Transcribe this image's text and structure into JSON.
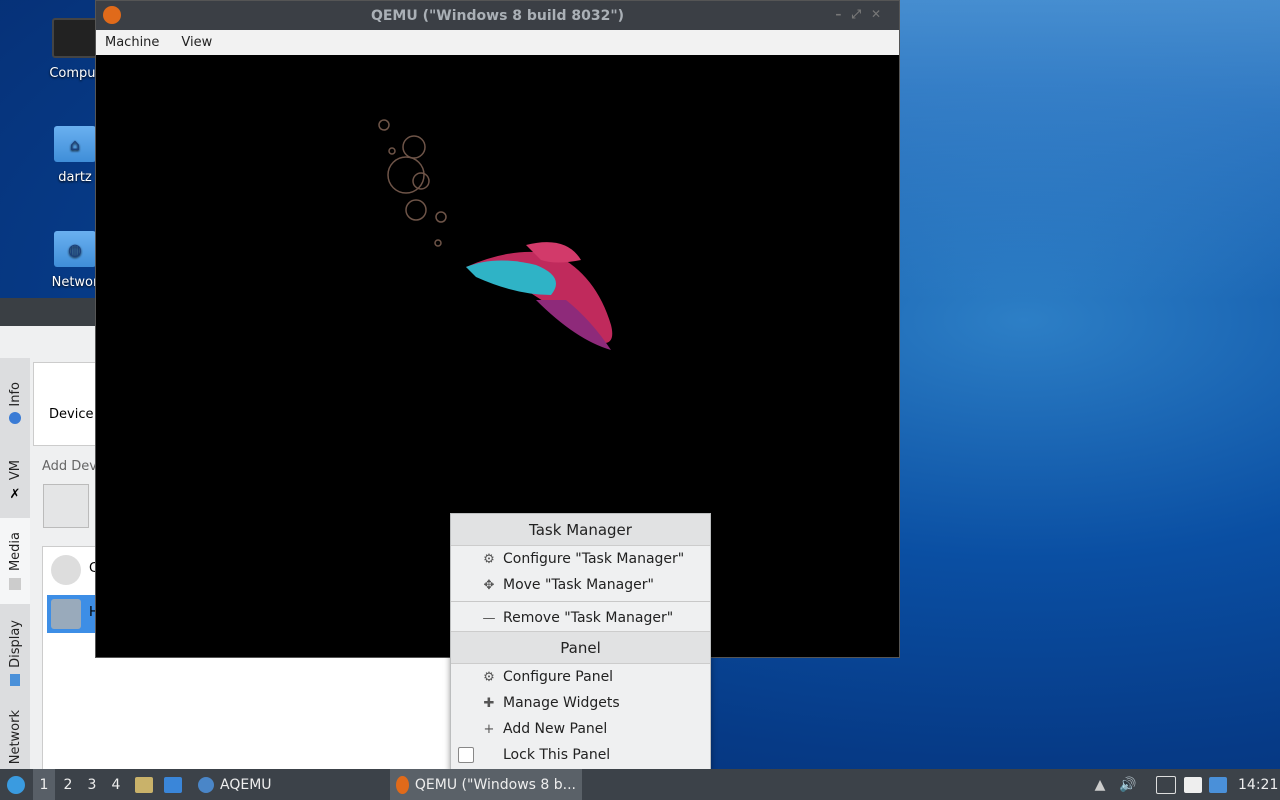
{
  "desktop": {
    "icons": [
      {
        "label": "Comput"
      },
      {
        "label": "dartz"
      },
      {
        "label": "Networ"
      }
    ]
  },
  "aqemu": {
    "side_tabs": [
      "Info",
      "VM",
      "Media",
      "Display",
      "Network"
    ],
    "devices_label": "Device",
    "add_label": "Add Dev",
    "rows": [
      "C",
      "H"
    ]
  },
  "qemu": {
    "title": "QEMU (\"Windows 8 build 8032\")",
    "menu": [
      "Machine",
      "View"
    ]
  },
  "context_menu": {
    "header1": "Task Manager",
    "items1": [
      {
        "label": "Configure \"Task Manager\"",
        "icon": "gear-icon"
      },
      {
        "label": "Move \"Task Manager\"",
        "icon": "move-icon"
      },
      {
        "label": "Remove \"Task Manager\"",
        "icon": "minus-icon"
      }
    ],
    "header2": "Panel",
    "items2": [
      {
        "label": "Configure Panel",
        "icon": "gear-icon"
      },
      {
        "label": "Manage Widgets",
        "icon": "puzzle-icon"
      },
      {
        "label": "Add New Panel",
        "icon": "plus-icon"
      },
      {
        "label": "Lock This Panel",
        "icon": "checkbox"
      }
    ]
  },
  "taskbar": {
    "desktops": [
      "1",
      "2",
      "3",
      "4"
    ],
    "aqemu_label": "AQEMU",
    "qemu_task_label": "QEMU (\"Windows 8 b...",
    "clock": "14:21"
  }
}
